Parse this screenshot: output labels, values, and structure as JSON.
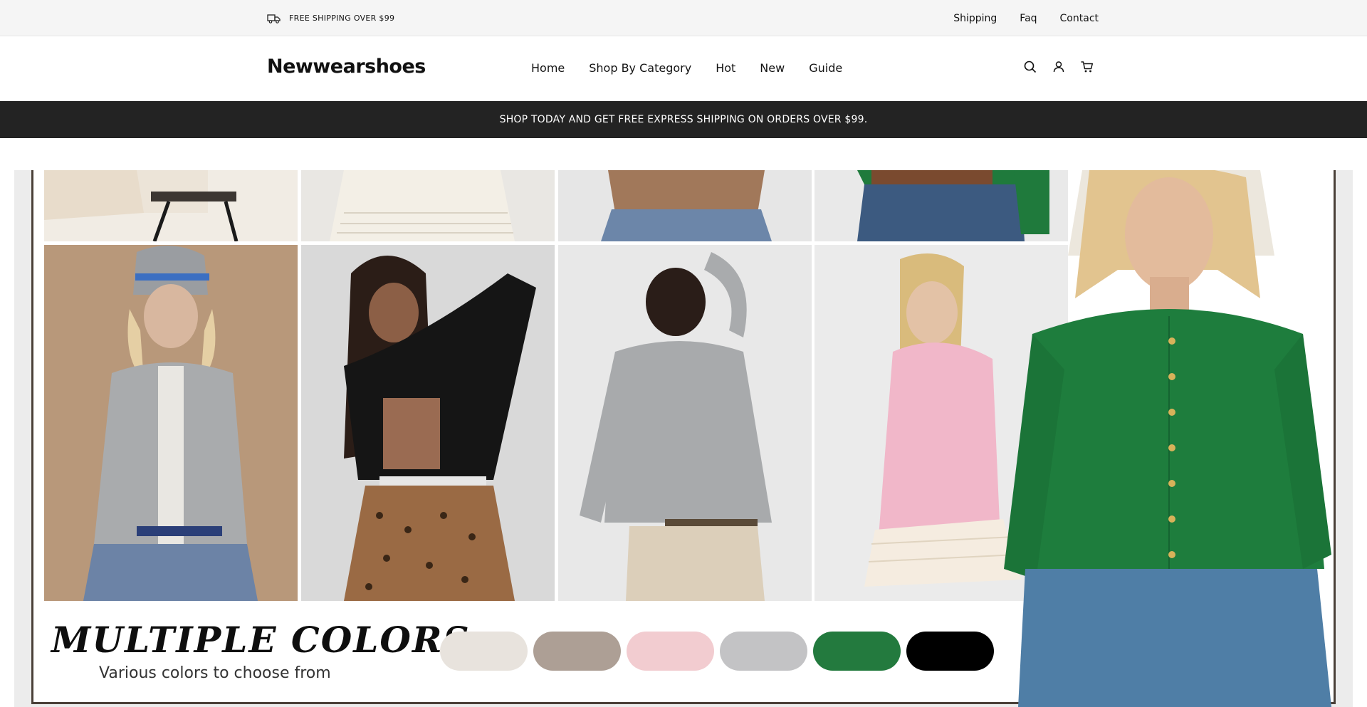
{
  "utility_bar": {
    "shipping_text": "FREE SHIPPING OVER $99",
    "links": [
      "Shipping",
      "Faq",
      "Contact"
    ]
  },
  "header": {
    "logo": "Newwearshoes",
    "nav": [
      "Home",
      "Shop By Category",
      "Hot",
      "New",
      "Guide"
    ],
    "icons": [
      "search-icon",
      "account-icon",
      "cart-icon"
    ]
  },
  "promo": {
    "text": "SHOP TODAY AND GET FREE EXPRESS SHIPPING ON ORDERS OVER $99."
  },
  "hero": {
    "title": "MULTIPLE COLORS",
    "subtitle": "Various colors to choose from",
    "swatches": [
      "#e8e3dd",
      "#ad9f95",
      "#f2ccd0",
      "#c3c3c5",
      "#237a3e",
      "#000000"
    ],
    "product_colors": {
      "grey": "#a9abad",
      "black": "#151515",
      "pink": "#f1b7c9",
      "green": "#1e7d3d"
    }
  }
}
